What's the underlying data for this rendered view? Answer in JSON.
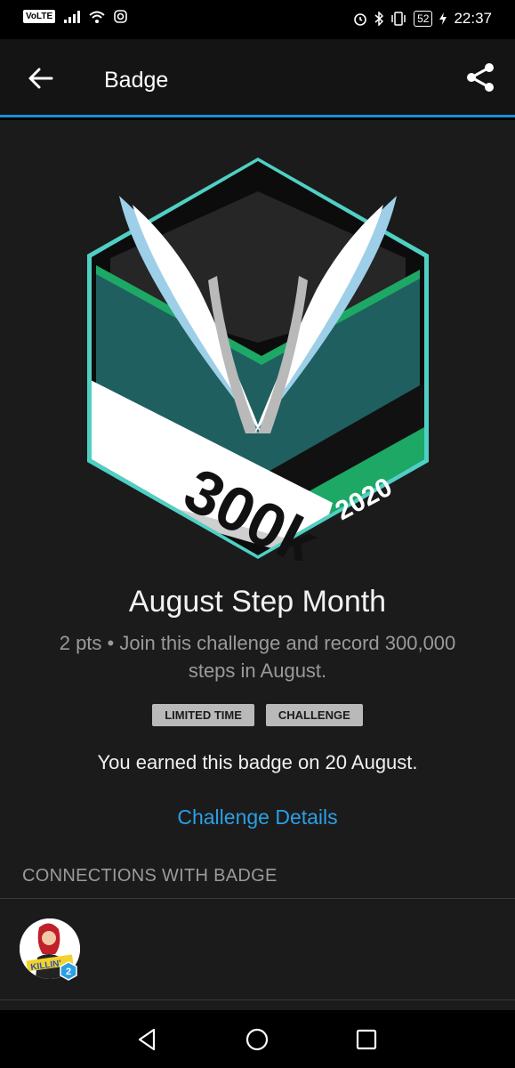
{
  "status_bar": {
    "network": "VoLTE",
    "battery": "52",
    "time": "22:37"
  },
  "app_bar": {
    "title": "Badge"
  },
  "badge": {
    "image_text": "300k",
    "image_year": "2020",
    "name": "August Step Month",
    "description": "2 pts • Join this challenge and record 300,000 steps in August.",
    "tags": [
      "LIMITED TIME",
      "CHALLENGE"
    ],
    "earned_text": "You earned this badge on 20 August.",
    "details_link": "Challenge Details"
  },
  "connections": {
    "header": "CONNECTIONS WITH BADGE",
    "items": [
      {
        "avatar_text": "KILLIN'",
        "level": "2"
      }
    ]
  },
  "colors": {
    "accent": "#1d8fd6",
    "link": "#2b9fe6",
    "badge_teal": "#1f5f5f",
    "badge_green": "#1ea866",
    "badge_outline": "#4fd0c4"
  }
}
